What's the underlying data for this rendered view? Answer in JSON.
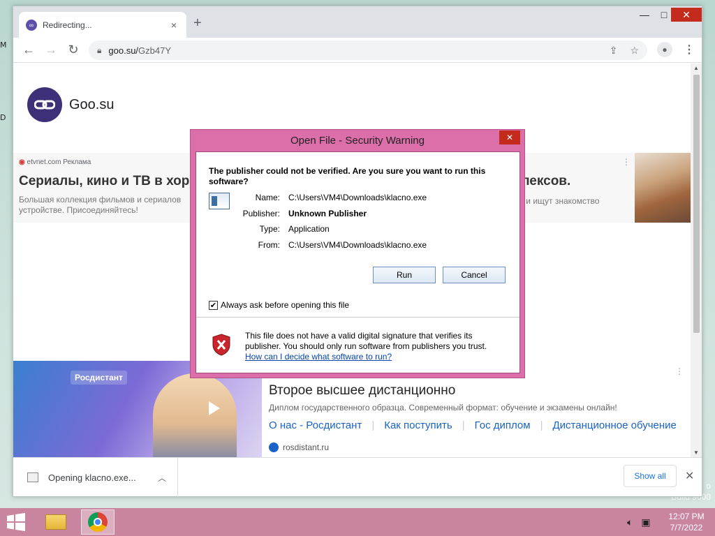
{
  "desktop": {
    "edge_letter": "M",
    "edge_letter2": "D",
    "build_line1": "o",
    "build_line2": "Build 9600"
  },
  "browser": {
    "tab_title": "Redirecting...",
    "tab_close": "×",
    "new_tab": "+",
    "win_min": "—",
    "win_max": "□",
    "win_close": "✕",
    "url_host": "goo.su/",
    "url_path": "Gzb47Y"
  },
  "page": {
    "brand": "Goo.su",
    "ad1": {
      "source": "etvnet.com",
      "source_tag": "Реклама",
      "headline": "Сериалы, кино и ТВ в хор",
      "headline_right": "плексов.",
      "desc": "Большая коллекция фильмов и сериалов устройстве. Присоединяйтесь!",
      "desc_right": "ми и ищут знакомство"
    },
    "ad2": {
      "brand": "Росдистант",
      "title": "Второе высшее дистанционно",
      "subtitle": "Диплом государственного образца. Современный формат: обучение и экзамены онлайн!",
      "links": [
        "О нас - Росдистант",
        "Как поступить",
        "Гос диплом",
        "Дистанционное обучение"
      ],
      "domain": "rosdistant.ru"
    }
  },
  "download_bar": {
    "file_label": "Opening klacno.exe...",
    "show_all": "Show all",
    "close": "✕"
  },
  "dialog": {
    "title": "Open File - Security Warning",
    "close": "✕",
    "question": "The publisher could not be verified.  Are you sure you want to run this software?",
    "name_label": "Name:",
    "name_value": "C:\\Users\\VM4\\Downloads\\klacno.exe",
    "publisher_label": "Publisher:",
    "publisher_value": "Unknown Publisher",
    "type_label": "Type:",
    "type_value": "Application",
    "from_label": "From:",
    "from_value": "C:\\Users\\VM4\\Downloads\\klacno.exe",
    "run_label": "Run",
    "cancel_label": "Cancel",
    "checkbox_label": "Always ask before opening this file",
    "checkbox_checked": true,
    "warning_text": "This file does not have a valid digital signature that verifies its publisher.  You should only run software from publishers you trust.",
    "help_link": "How can I decide what software to run?"
  },
  "taskbar": {
    "time": "12:07 PM",
    "date": "7/7/2022"
  },
  "colors": {
    "accent_window": "#dc6faa",
    "taskbar": "#c9849f",
    "link": "#1a62c5"
  }
}
